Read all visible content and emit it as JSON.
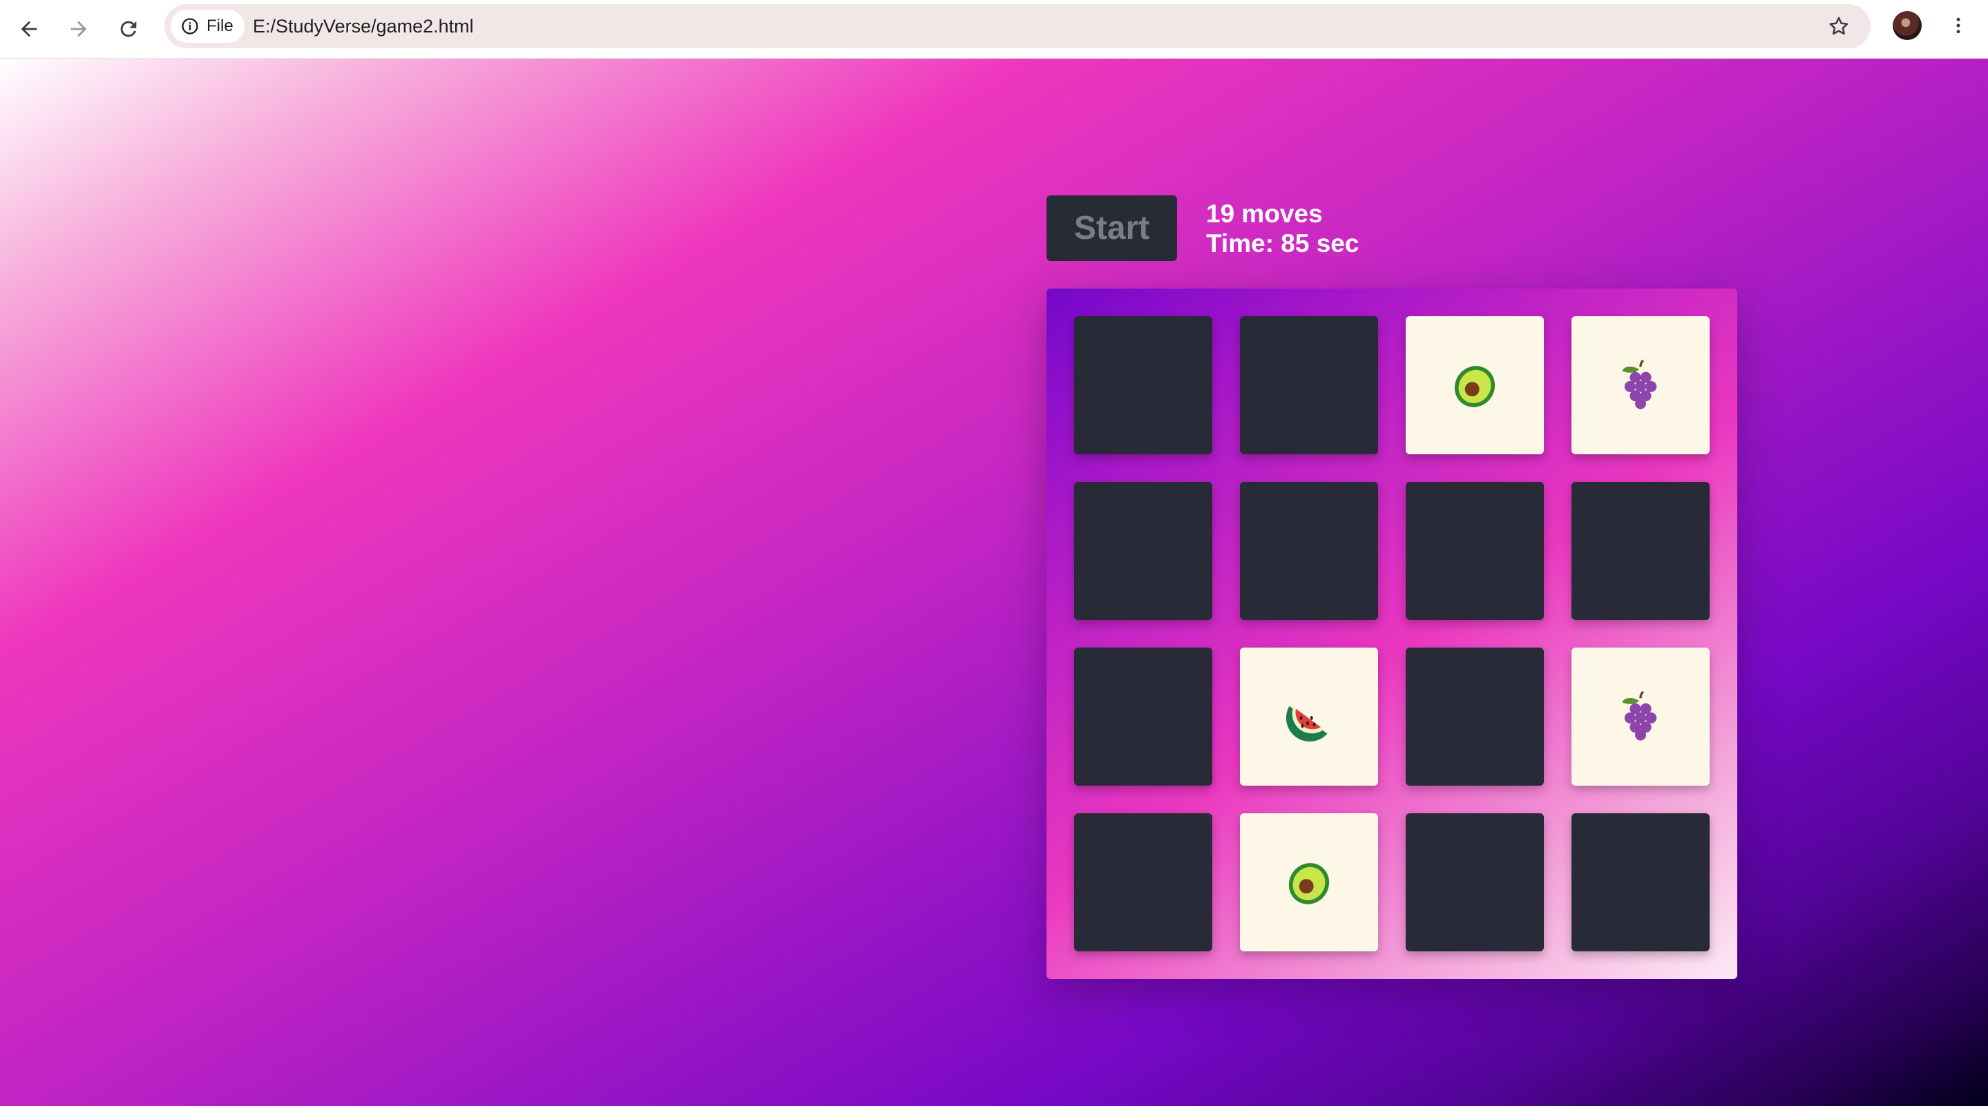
{
  "browser": {
    "site_chip_label": "File",
    "url": "E:/StudyVerse/game2.html",
    "icons": {
      "back": "arrow-left-icon",
      "forward": "arrow-right-icon",
      "reload": "reload-icon",
      "site_info": "info-icon",
      "bookmark": "star-icon",
      "menu": "more-vertical-icon"
    }
  },
  "game": {
    "start_label": "Start",
    "moves_text": "19 moves",
    "time_text": "Time: 85 sec",
    "colors": {
      "card_back": "#282a37",
      "card_face": "#fcf7e6",
      "button_text": "#7a7c86"
    },
    "board": {
      "rows": 4,
      "cols": 4,
      "cards": [
        "",
        "",
        "avocado",
        "grapes",
        "",
        "",
        "",
        "",
        "",
        "watermelon",
        "",
        "grapes",
        "",
        "avocado",
        "",
        ""
      ]
    }
  }
}
